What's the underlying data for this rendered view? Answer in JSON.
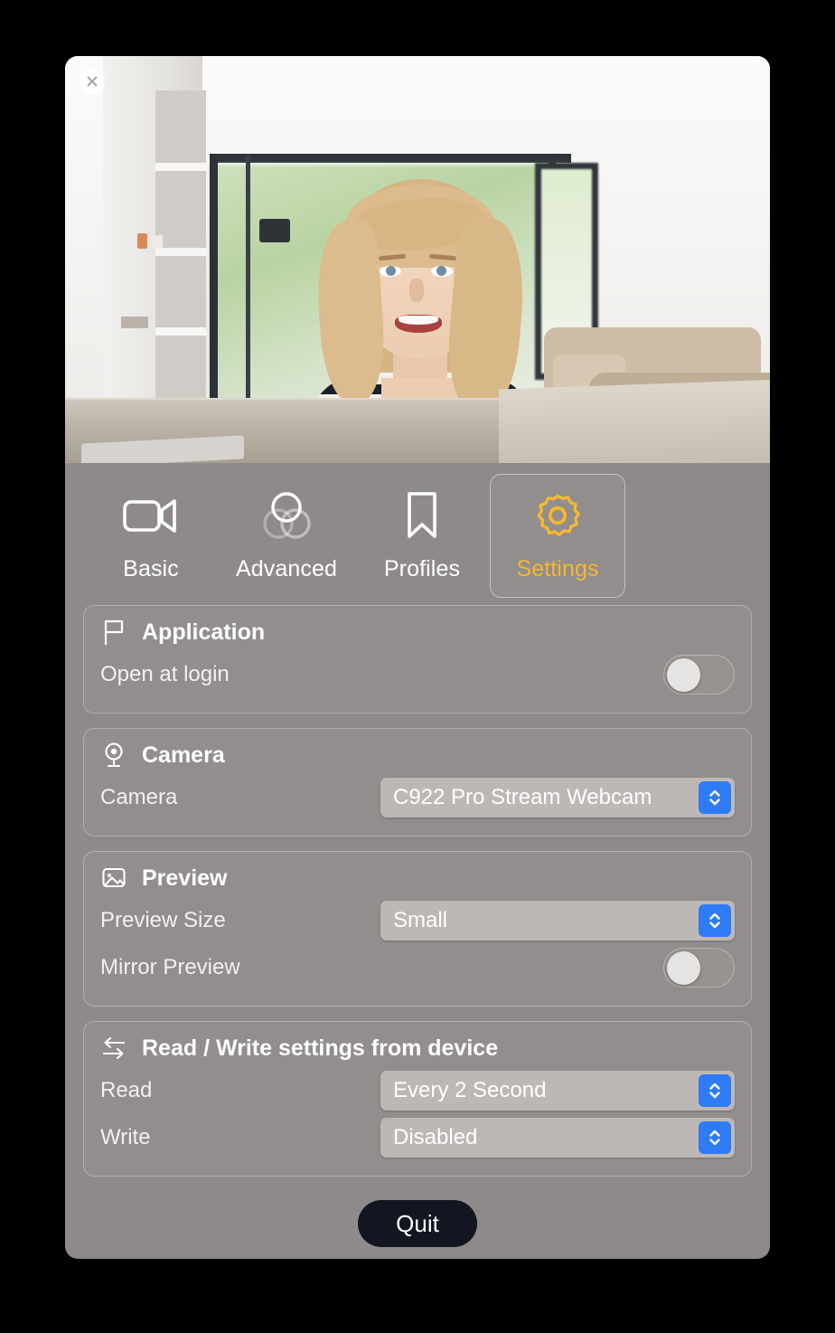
{
  "window": {
    "close_label": "close",
    "close_icon": "close-circle-icon"
  },
  "preview": {
    "alt": "webcam live preview of a smiling blonde woman in a striped top seated at a table"
  },
  "tabs": [
    {
      "label": "Basic",
      "icon": "video-camera-icon",
      "active": false
    },
    {
      "label": "Advanced",
      "icon": "overlapping-circles-icon",
      "active": false
    },
    {
      "label": "Profiles",
      "icon": "bookmark-icon",
      "active": false
    },
    {
      "label": "Settings",
      "icon": "gear-icon",
      "active": true
    }
  ],
  "sections": {
    "application": {
      "title": "Application",
      "icon": "flag-icon",
      "open_at_login": {
        "label": "Open at login",
        "value": false
      }
    },
    "camera": {
      "title": "Camera",
      "icon": "webcam-icon",
      "camera_select": {
        "label": "Camera",
        "value": "C922 Pro Stream Webcam"
      }
    },
    "preview": {
      "title": "Preview",
      "icon": "image-icon",
      "preview_size": {
        "label": "Preview Size",
        "value": "Small"
      },
      "mirror_preview": {
        "label": "Mirror Preview",
        "value": false
      }
    },
    "readwrite": {
      "title": "Read / Write settings from device",
      "icon": "read-write-arrows-icon",
      "read": {
        "label": "Read",
        "value": "Every 2 Second"
      },
      "write": {
        "label": "Write",
        "value": "Disabled"
      }
    }
  },
  "footer": {
    "quit_label": "Quit"
  },
  "colors": {
    "accent": "#f5b731",
    "panel": "#8e8a89",
    "popup_chevron": "#2f7bf5",
    "quit_bg": "#131621"
  }
}
